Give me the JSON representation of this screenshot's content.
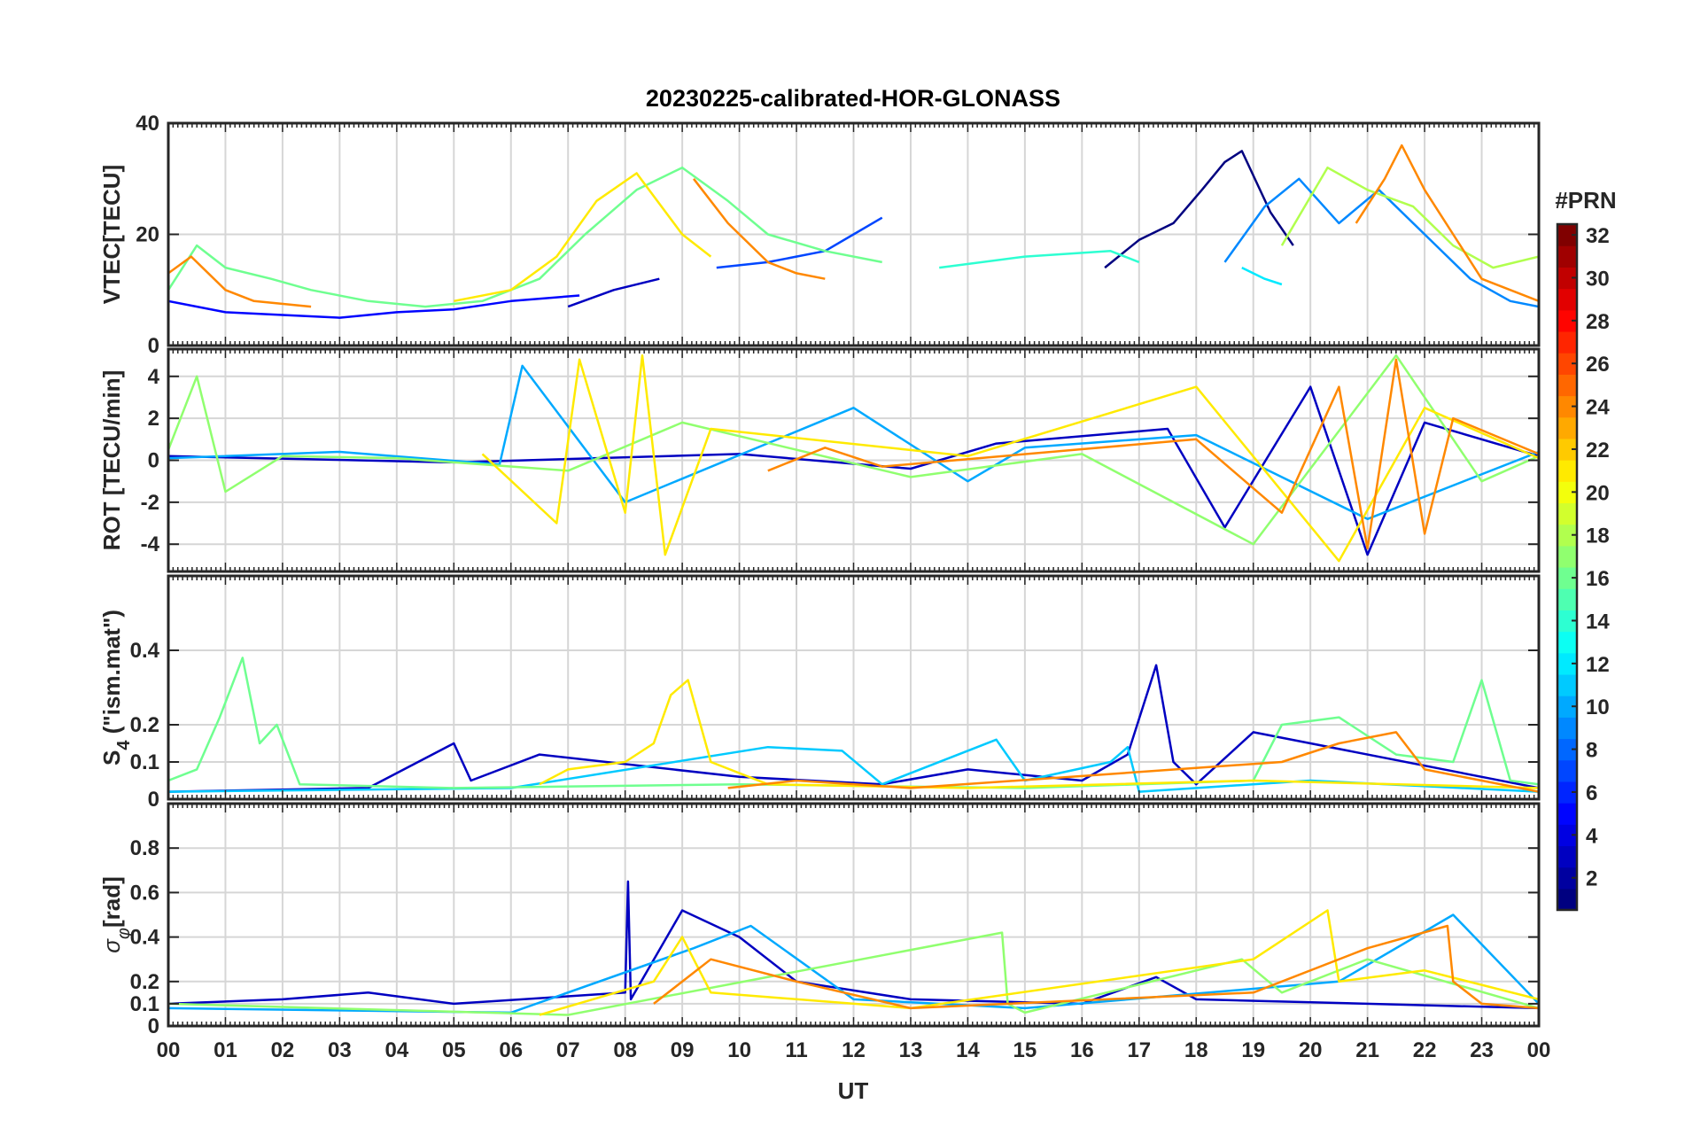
{
  "chart_data": {
    "type": "line",
    "title": "20230225-calibrated-HOR-GLONASS",
    "xlabel": "UT",
    "x_ticks": [
      "00",
      "01",
      "02",
      "03",
      "04",
      "05",
      "06",
      "07",
      "08",
      "09",
      "10",
      "11",
      "12",
      "13",
      "14",
      "15",
      "16",
      "17",
      "18",
      "19",
      "20",
      "21",
      "22",
      "23",
      "00"
    ],
    "xlim": [
      0,
      24
    ],
    "grid": true,
    "panels": [
      {
        "id": "vtec",
        "ylabel": "VTEC[TECU]",
        "ylim": [
          0,
          40
        ],
        "yticks": [
          0,
          20,
          40
        ],
        "ytick_labels": [
          "0",
          "20",
          "40"
        ],
        "series": [
          {
            "prn": 1,
            "x": [
              16.4,
              17.0,
              17.6,
              18.1,
              18.5,
              18.8,
              19.3,
              19.7
            ],
            "y": [
              14,
              19,
              22,
              28,
              33,
              35,
              24,
              18
            ]
          },
          {
            "prn": 3,
            "x": [
              7.0,
              7.8,
              8.6
            ],
            "y": [
              7,
              10,
              12
            ]
          },
          {
            "prn": 5,
            "x": [
              0,
              1,
              2,
              3,
              4,
              5,
              6,
              7.2
            ],
            "y": [
              8,
              6,
              5.5,
              5,
              6,
              6.5,
              8,
              9
            ]
          },
          {
            "prn": 7,
            "x": [
              9.6,
              10.5,
              11.5,
              12.0,
              12.5
            ],
            "y": [
              14,
              15,
              17,
              20,
              23
            ]
          },
          {
            "prn": 9,
            "x": [
              18.5,
              19.2,
              19.8,
              20.5,
              21.2,
              22.0,
              22.8,
              23.5,
              24
            ],
            "y": [
              15,
              25,
              30,
              22,
              28,
              20,
              12,
              8,
              7
            ]
          },
          {
            "prn": 12,
            "x": [
              18.8,
              19.2,
              19.5
            ],
            "y": [
              14,
              12,
              11
            ]
          },
          {
            "prn": 14,
            "x": [
              13.5,
              15.0,
              16.5,
              17.0
            ],
            "y": [
              14,
              16,
              17,
              15
            ]
          },
          {
            "prn": 16,
            "x": [
              0,
              0.5,
              1.0,
              1.8,
              2.5,
              3.5,
              4.5,
              5.5,
              6.5,
              7.3,
              8.2,
              9.0,
              9.8,
              10.5,
              11.5,
              12.5
            ],
            "y": [
              10,
              18,
              14,
              12,
              10,
              8,
              7,
              8,
              12,
              20,
              28,
              32,
              26,
              20,
              17,
              15
            ]
          },
          {
            "prn": 18,
            "x": [
              19.5,
              20.3,
              21.0,
              21.8,
              22.5,
              23.2,
              24
            ],
            "y": [
              18,
              32,
              28,
              25,
              18,
              14,
              16
            ]
          },
          {
            "prn": 21,
            "x": [
              5.0,
              6.0,
              6.8,
              7.5,
              8.2,
              9.0,
              9.5
            ],
            "y": [
              8,
              10,
              16,
              26,
              31,
              20,
              16
            ]
          },
          {
            "prn": 24,
            "x": [
              0,
              0.4,
              1.0,
              1.5,
              2.5
            ],
            "y": [
              13,
              16,
              10,
              8,
              7
            ]
          },
          {
            "prn": 24,
            "x": [
              9.2,
              9.8,
              10.5,
              11.0,
              11.5
            ],
            "y": [
              30,
              22,
              15,
              13,
              12
            ]
          },
          {
            "prn": 24,
            "x": [
              20.8,
              21.3,
              21.6,
              22.0,
              22.5,
              23.0,
              24
            ],
            "y": [
              22,
              30,
              36,
              28,
              20,
              12,
              8
            ]
          }
        ]
      },
      {
        "id": "rot",
        "ylabel": "ROT [TECU/min]",
        "ylim": [
          -5.3,
          5.3
        ],
        "yticks": [
          -4,
          -2,
          0,
          2,
          4
        ],
        "ytick_labels": [
          "-4",
          "-2",
          "0",
          "2",
          "4"
        ],
        "series": [
          {
            "prn": 3,
            "x": [
              0,
              5,
              10,
              13,
              14.5,
              17.5,
              18.5,
              20,
              21,
              22,
              24
            ],
            "y": [
              0.2,
              -0.1,
              0.3,
              -0.4,
              0.8,
              1.5,
              -3.2,
              3.5,
              -4.5,
              1.8,
              0.2
            ]
          },
          {
            "prn": 10,
            "x": [
              0,
              3,
              5.8,
              6.2,
              8,
              12,
              14,
              15,
              18,
              21,
              24
            ],
            "y": [
              0.1,
              0.4,
              -0.2,
              4.5,
              -2.0,
              2.5,
              -1.0,
              0.6,
              1.2,
              -2.8,
              0.4
            ]
          },
          {
            "prn": 17,
            "x": [
              0,
              0.5,
              1,
              2,
              4,
              7,
              9,
              13,
              16,
              19,
              21.5,
              23,
              24
            ],
            "y": [
              0.5,
              4.0,
              -1.5,
              0.2,
              0.1,
              -0.5,
              1.8,
              -0.8,
              0.3,
              -4.0,
              5.0,
              -1.0,
              0.2
            ]
          },
          {
            "prn": 21,
            "x": [
              5.5,
              6.8,
              7.2,
              8.0,
              8.3,
              8.7,
              9.5,
              14,
              18,
              20.5,
              22,
              24
            ],
            "y": [
              0.3,
              -3.0,
              4.8,
              -2.5,
              5.0,
              -4.5,
              1.5,
              0.2,
              3.5,
              -4.8,
              2.5,
              0.1
            ]
          },
          {
            "prn": 24,
            "x": [
              10.5,
              11.5,
              12.5,
              18,
              19.5,
              20.5,
              21.0,
              21.5,
              22.0,
              22.5,
              24
            ],
            "y": [
              -0.5,
              0.6,
              -0.3,
              1.0,
              -2.5,
              3.5,
              -4.2,
              4.8,
              -3.5,
              2.0,
              0.3
            ]
          }
        ]
      },
      {
        "id": "s4",
        "ylabel": "S4 (\"ism.mat\")",
        "ylim": [
          0,
          0.6
        ],
        "yticks": [
          0,
          0.1,
          0.2,
          0.4
        ],
        "ytick_labels": [
          "0",
          "0.1",
          "0.2",
          "0.4"
        ],
        "series": [
          {
            "prn": 3,
            "x": [
              0,
              3.5,
              5.0,
              5.3,
              6.5,
              10,
              12.5,
              14,
              16,
              16.8,
              17.3,
              17.6,
              18,
              19,
              24
            ],
            "y": [
              0.02,
              0.03,
              0.15,
              0.05,
              0.12,
              0.06,
              0.04,
              0.08,
              0.05,
              0.12,
              0.36,
              0.1,
              0.04,
              0.18,
              0.03
            ]
          },
          {
            "prn": 11,
            "x": [
              0,
              6,
              10.5,
              11.8,
              12.5,
              14.5,
              15,
              16.5,
              16.8,
              17.0,
              20,
              24
            ],
            "y": [
              0.02,
              0.03,
              0.14,
              0.13,
              0.04,
              0.16,
              0.05,
              0.1,
              0.14,
              0.02,
              0.05,
              0.02
            ]
          },
          {
            "prn": 16,
            "x": [
              0,
              0.5,
              0.9,
              1.3,
              1.6,
              1.9,
              2.3,
              5,
              10,
              15,
              19,
              19.5,
              20.5,
              21.5,
              22.5,
              23.0,
              23.5,
              24
            ],
            "y": [
              0.05,
              0.08,
              0.22,
              0.38,
              0.15,
              0.2,
              0.04,
              0.03,
              0.04,
              0.03,
              0.05,
              0.2,
              0.22,
              0.12,
              0.1,
              0.32,
              0.05,
              0.04
            ]
          },
          {
            "prn": 21,
            "x": [
              6.5,
              7.0,
              8.0,
              8.5,
              8.8,
              9.1,
              9.5,
              10.5,
              14,
              19,
              24
            ],
            "y": [
              0.04,
              0.08,
              0.1,
              0.15,
              0.28,
              0.32,
              0.1,
              0.04,
              0.03,
              0.05,
              0.03
            ]
          },
          {
            "prn": 24,
            "x": [
              9.8,
              11,
              13,
              19.5,
              20.5,
              21.5,
              22,
              23,
              24
            ],
            "y": [
              0.03,
              0.05,
              0.03,
              0.1,
              0.15,
              0.18,
              0.08,
              0.05,
              0.02
            ]
          }
        ]
      },
      {
        "id": "sigma_phi",
        "ylabel": "σφ[rad]",
        "ylim": [
          0,
          1.0
        ],
        "yticks": [
          0,
          0.1,
          0.2,
          0.4,
          0.6,
          0.8
        ],
        "ytick_labels": [
          "0",
          "0.1",
          "0.2",
          "0.4",
          "0.6",
          "0.8"
        ],
        "series": [
          {
            "prn": 3,
            "x": [
              0,
              2,
              3.5,
              5,
              8.0,
              8.05,
              8.1,
              9,
              10,
              11,
              13,
              16,
              17.3,
              18,
              24
            ],
            "y": [
              0.1,
              0.12,
              0.15,
              0.1,
              0.15,
              0.65,
              0.12,
              0.52,
              0.4,
              0.2,
              0.12,
              0.1,
              0.22,
              0.12,
              0.08
            ]
          },
          {
            "prn": 10,
            "x": [
              0,
              6,
              9.2,
              10.2,
              12,
              15,
              20.5,
              22.5,
              24
            ],
            "y": [
              0.08,
              0.06,
              0.35,
              0.45,
              0.12,
              0.08,
              0.2,
              0.5,
              0.1
            ]
          },
          {
            "prn": 17,
            "x": [
              0,
              7,
              14.6,
              14.7,
              15,
              18.8,
              19.5,
              21,
              24
            ],
            "y": [
              0.1,
              0.05,
              0.42,
              0.1,
              0.06,
              0.3,
              0.15,
              0.3,
              0.08
            ]
          },
          {
            "prn": 21,
            "x": [
              6.5,
              8.5,
              9.0,
              9.5,
              13,
              19,
              20.3,
              20.5,
              22,
              24
            ],
            "y": [
              0.05,
              0.2,
              0.4,
              0.15,
              0.08,
              0.3,
              0.52,
              0.2,
              0.25,
              0.12
            ]
          },
          {
            "prn": 24,
            "x": [
              8.5,
              9.5,
              11,
              13,
              19,
              21,
              22.4,
              22.5,
              23,
              24
            ],
            "y": [
              0.1,
              0.3,
              0.2,
              0.08,
              0.15,
              0.35,
              0.45,
              0.2,
              0.1,
              0.08
            ]
          }
        ]
      }
    ],
    "colorbar": {
      "label": "#PRN",
      "colormap": "jet",
      "range": [
        1,
        32
      ],
      "ticks": [
        2,
        4,
        6,
        8,
        10,
        12,
        14,
        16,
        18,
        20,
        22,
        24,
        26,
        28,
        30,
        32
      ],
      "tick_labels": [
        "2",
        "4",
        "6",
        "8",
        "10",
        "12",
        "14",
        "16",
        "18",
        "20",
        "22",
        "24",
        "26",
        "28",
        "30",
        "32"
      ]
    }
  }
}
